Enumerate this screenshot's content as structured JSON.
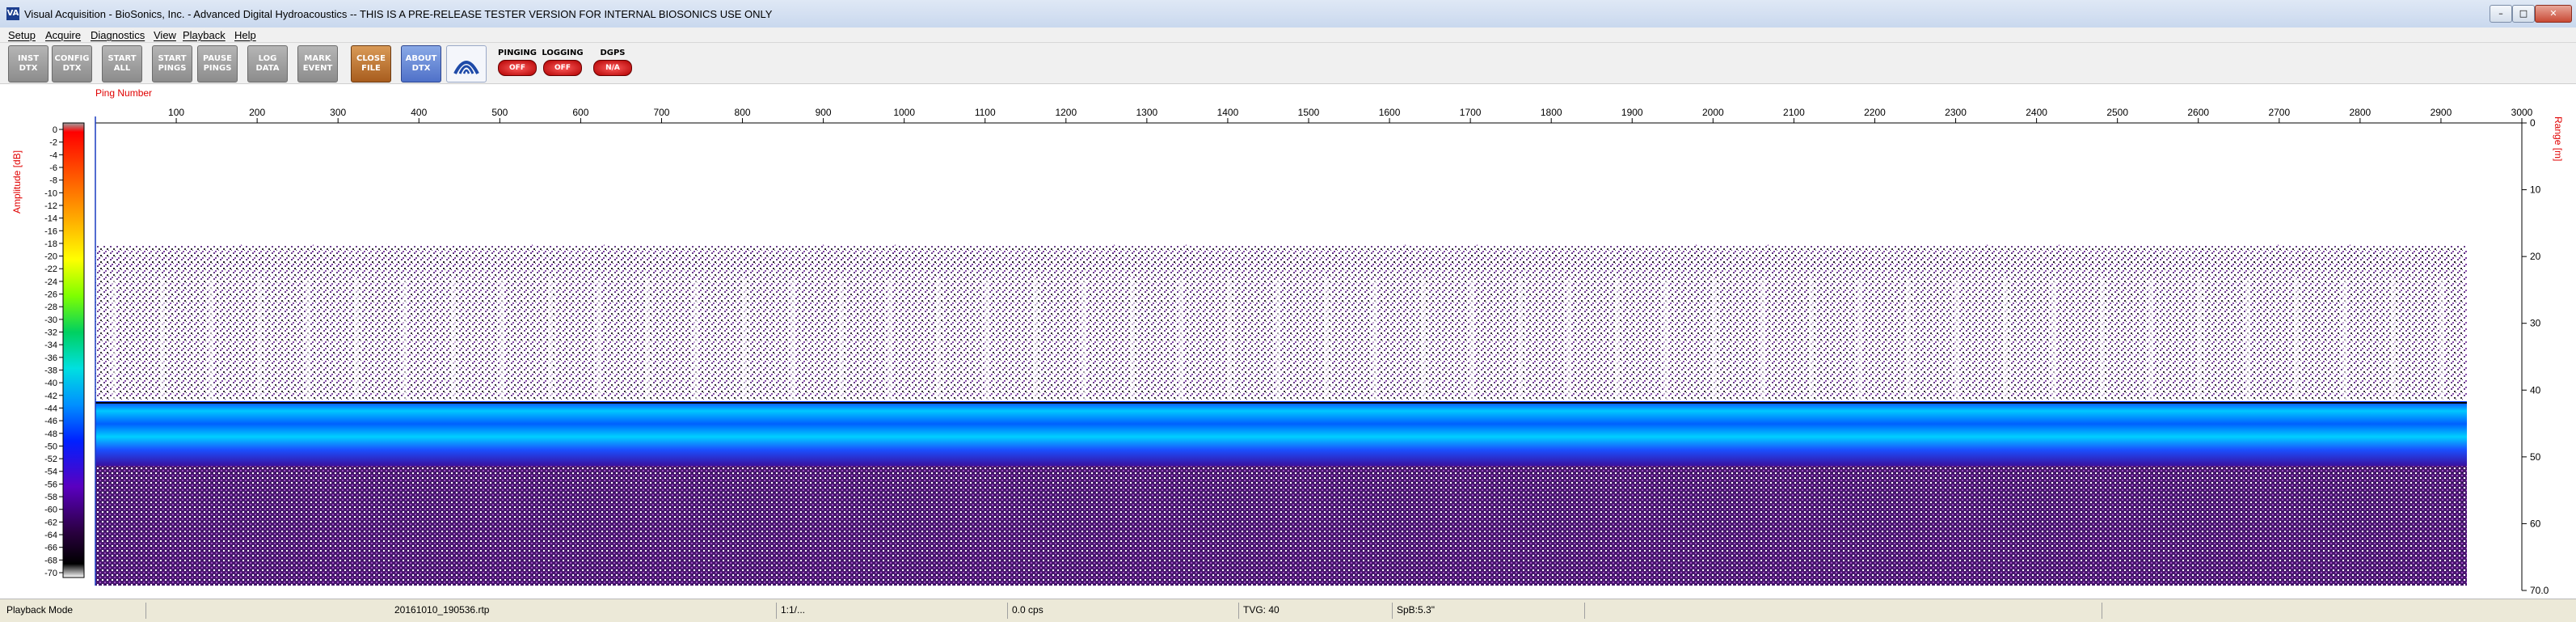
{
  "window": {
    "title": "Visual Acquisition  -  BioSonics, Inc.  -  Advanced Digital Hydroacoustics  -- THIS IS A PRE-RELEASE TESTER VERSION FOR INTERNAL BIOSONICS USE ONLY",
    "icon": "VA",
    "min": "–",
    "max": "□",
    "close": "✕"
  },
  "menu": [
    "Setup",
    "Acquire",
    "Diagnostics",
    "View",
    "Playback",
    "Help"
  ],
  "toolbar": {
    "buttons": [
      {
        "name": "inst-dtx",
        "label": "INST\nDTX",
        "style": "gray"
      },
      {
        "name": "config-dtx",
        "label": "CONFIG\nDTX",
        "style": "gray"
      },
      {
        "name": "start-all",
        "label": "START\nALL",
        "style": "gray"
      },
      {
        "name": "start-pings",
        "label": "START\nPINGS",
        "style": "gray"
      },
      {
        "name": "pause-pings",
        "label": "PAUSE\nPINGS",
        "style": "gray"
      },
      {
        "name": "log-data",
        "label": "LOG\nDATA",
        "style": "gray"
      },
      {
        "name": "mark-event",
        "label": "MARK\nEVENT",
        "style": "gray"
      },
      {
        "name": "close-file",
        "label": "CLOSE\nFILE",
        "style": "orange"
      },
      {
        "name": "about-dtx",
        "label": "ABOUT\nDTX",
        "style": "blue"
      }
    ],
    "status": [
      {
        "name": "pinging",
        "label": "PINGING",
        "value": "OFF"
      },
      {
        "name": "logging",
        "label": "LOGGING",
        "value": "OFF"
      },
      {
        "name": "dgps",
        "label": "DGPS",
        "value": "N/A"
      }
    ]
  },
  "plot": {
    "amplitude_label": "Amplitude [dB]",
    "range_label": "Range [m]",
    "ping_label": "Ping Number",
    "amplitude_ticks": [
      "0",
      "-2",
      "-4",
      "-6",
      "-8",
      "-10",
      "-12",
      "-14",
      "-16",
      "-18",
      "-20",
      "-22",
      "-24",
      "-26",
      "-28",
      "-30",
      "-32",
      "-34",
      "-36",
      "-38",
      "-40",
      "-42",
      "-44",
      "-46",
      "-48",
      "-50",
      "-52",
      "-54",
      "-56",
      "-58",
      "-60",
      "-62",
      "-64",
      "-66",
      "-68",
      "-70"
    ],
    "ping_ticks": [
      100,
      200,
      300,
      400,
      500,
      600,
      700,
      800,
      900,
      1000,
      1100,
      1200,
      1300,
      1400,
      1500,
      1600,
      1700,
      1800,
      1900,
      2000,
      2100,
      2200,
      2300,
      2400,
      2500,
      2600,
      2700,
      2800,
      2900,
      3000
    ],
    "range_ticks": [
      "0",
      "10",
      "20",
      "30",
      "40",
      "50",
      "60",
      "70.0"
    ]
  },
  "statusbar": {
    "mode": "Playback Mode",
    "file": "20161010_190536.rtp",
    "ratio": "1:1/...",
    "rate": "0.0 cps",
    "tvg": "TVG: 40",
    "spb": "SpB:5.3\""
  },
  "colors": {
    "scale_top": "#9a9a9a",
    "red": "#e00000"
  }
}
